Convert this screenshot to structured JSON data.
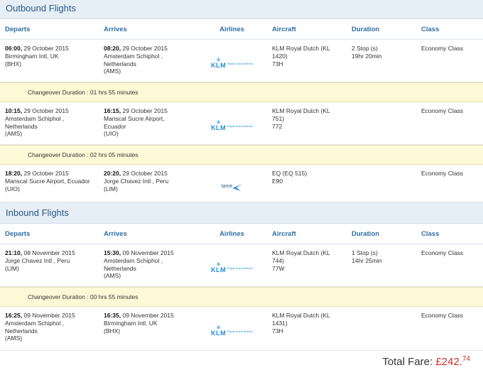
{
  "outbound": {
    "title": "Outbound Flights",
    "columns": [
      "Departs",
      "Arrives",
      "Airlines",
      "Aircraft",
      "Duration",
      "Class"
    ],
    "legs": [
      {
        "dep_time": "06:00,",
        "dep_date": " 29 October 2015",
        "dep_line2": "Birmingham Intl, UK",
        "dep_line3": "(BHX)",
        "dep_line4": "",
        "arr_time": "08:20,",
        "arr_date": " 29 October 2015",
        "arr_line2": "Amsterdam Schiphol ,",
        "arr_line3": "Netherlands",
        "arr_line4": "(AMS)",
        "airline": "klm",
        "aircraft1": "KLM Royal Dutch (KL",
        "aircraft2": "1420)",
        "aircraft3": "73H",
        "duration1": "2 Stop (s)",
        "duration2": "19hr 20min",
        "class": "Economy Class"
      },
      {
        "dep_time": "10:15,",
        "dep_date": " 29 October 2015",
        "dep_line2": "Amsterdam Schiphol ,",
        "dep_line3": "Netherlands",
        "dep_line4": "(AMS)",
        "arr_time": "16:15,",
        "arr_date": " 29 October 2015",
        "arr_line2": "Mariscal Sucre Airport,",
        "arr_line3": "Ecuador",
        "arr_line4": "(UIO)",
        "airline": "klm",
        "aircraft1": "KLM Royal Dutch (KL",
        "aircraft2": "751)",
        "aircraft3": "772",
        "duration1": "",
        "duration2": "",
        "class": "Economy Class"
      },
      {
        "dep_time": "18:20,",
        "dep_date": " 29 October 2015",
        "dep_line2": "Mariscal Sucre Airport, Ecuador",
        "dep_line3": "(UIO)",
        "dep_line4": "",
        "arr_time": "20:20,",
        "arr_date": " 29 October 2015",
        "arr_line2": "Jorge Chavez Intl , Peru",
        "arr_line3": "(LIM)",
        "arr_line4": "",
        "airline": "tame",
        "aircraft1": "EQ (EQ 515)",
        "aircraft2": "E90",
        "aircraft3": "",
        "duration1": "",
        "duration2": "",
        "class": "Economy Class"
      }
    ],
    "changeovers": [
      "Changeover Duration : 01 hrs 55 minutes",
      "Changeover Duration : 02 hrs 05 minutes"
    ]
  },
  "inbound": {
    "title": "Inbound Flights",
    "columns": [
      "Departs",
      "Arrives",
      "Airlines",
      "Aircraft",
      "Duration",
      "Class"
    ],
    "legs": [
      {
        "dep_time": "21:10,",
        "dep_date": " 08 November 2015",
        "dep_line2": "Jorge Chavez Intl , Peru",
        "dep_line3": "(LIM)",
        "dep_line4": "",
        "arr_time": "15:30,",
        "arr_date": " 09 November 2015",
        "arr_line2": "Amsterdam Schiphol ,",
        "arr_line3": "Netherlands",
        "arr_line4": "(AMS)",
        "airline": "klm",
        "aircraft1": "KLM Royal Dutch (KL",
        "aircraft2": "744)",
        "aircraft3": "77W",
        "duration1": "1 Stop (s)",
        "duration2": "14hr 25min",
        "class": "Economy Class"
      },
      {
        "dep_time": "16:25,",
        "dep_date": " 09 November 2015",
        "dep_line2": "Amsterdam Schiphol ,",
        "dep_line3": "Netherlands",
        "dep_line4": "(AMS)",
        "arr_time": "16:35,",
        "arr_date": " 09 November 2015",
        "arr_line2": "Birmingham Intl, UK",
        "arr_line3": "(BHX)",
        "arr_line4": "",
        "airline": "klm",
        "aircraft1": "KLM Royal Dutch (KL",
        "aircraft2": "1431)",
        "aircraft3": "73H",
        "duration1": "",
        "duration2": "",
        "class": "Economy Class"
      }
    ],
    "changeovers": [
      "Changeover Duration : 00 hrs 55 minutes"
    ]
  },
  "logos": {
    "klm_text": "KLM",
    "klm_sub": "Royal Dutch Airlines",
    "tame_text": "tame"
  },
  "total": {
    "label": "Total Fare:",
    "currency": "£",
    "whole": "242.",
    "fraction": "74"
  },
  "colors": {
    "header_bg": "#e6eef6",
    "link_blue": "#2e6da4",
    "changeover_bg": "#fdf8d6",
    "price_red": "#c9302c"
  }
}
